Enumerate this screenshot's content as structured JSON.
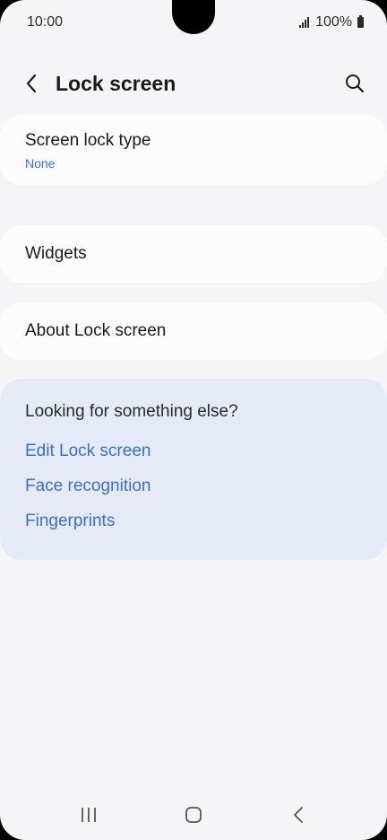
{
  "status": {
    "time": "10:00",
    "battery": "100%"
  },
  "header": {
    "title": "Lock screen"
  },
  "items": {
    "lock_type": {
      "label": "Screen lock type",
      "value": "None"
    },
    "widgets": {
      "label": "Widgets"
    },
    "about": {
      "label": "About Lock screen"
    }
  },
  "suggestions": {
    "heading": "Looking for something else?",
    "links": [
      "Edit Lock screen",
      "Face recognition",
      "Fingerprints"
    ]
  },
  "icons": {
    "back": "chevron-left-icon",
    "search": "search-icon",
    "recents": "recents-icon",
    "home": "home-icon",
    "nav_back": "back-icon"
  },
  "colors": {
    "accent": "#3c6fc4",
    "background": "#f5f5f7",
    "card": "#fcfcfd",
    "suggest_bg": "#e6eaf6"
  }
}
